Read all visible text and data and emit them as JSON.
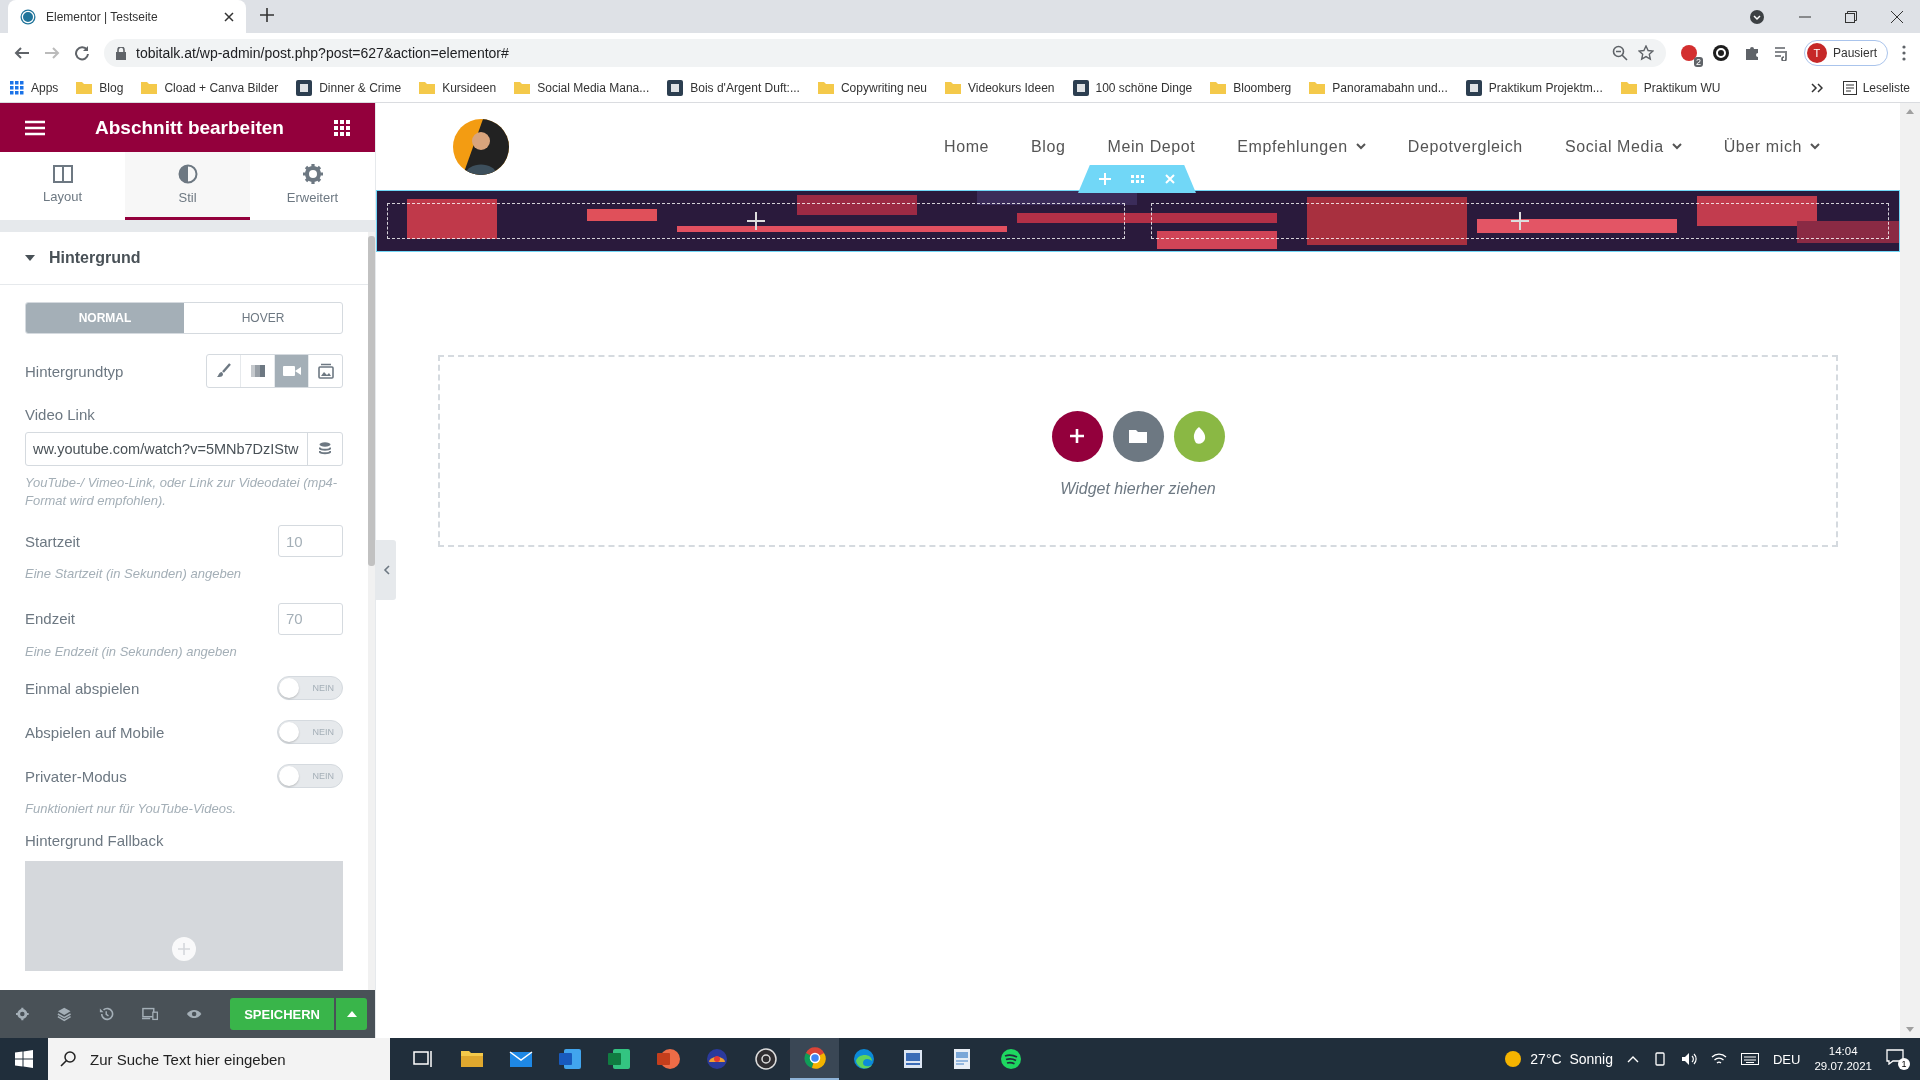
{
  "browser": {
    "tab": {
      "title": "Elementor | Testseite"
    },
    "url": "tobitalk.at/wp-admin/post.php?post=627&action=elementor#",
    "extension_badge": "2",
    "profile": {
      "initial": "T",
      "label": "Pausiert"
    },
    "bookmarks": [
      {
        "label": "Apps",
        "kind": "apps"
      },
      {
        "label": "Blog",
        "kind": "folder"
      },
      {
        "label": "Cload + Canva Bilder",
        "kind": "folder"
      },
      {
        "label": "Dinner & Crime",
        "kind": "site"
      },
      {
        "label": "Kursideen",
        "kind": "folder"
      },
      {
        "label": "Social Media Mana...",
        "kind": "folder"
      },
      {
        "label": "Bois d'Argent Duft:...",
        "kind": "site"
      },
      {
        "label": "Copywriting neu",
        "kind": "folder"
      },
      {
        "label": "Videokurs Ideen",
        "kind": "folder"
      },
      {
        "label": "100 schöne Dinge",
        "kind": "site"
      },
      {
        "label": "Bloomberg",
        "kind": "folder"
      },
      {
        "label": "Panoramabahn und...",
        "kind": "folder"
      },
      {
        "label": "Praktikum Projektm...",
        "kind": "site"
      },
      {
        "label": "Praktikum WU",
        "kind": "folder"
      }
    ],
    "reading_list": "Leseliste"
  },
  "editor": {
    "title": "Abschnitt bearbeiten",
    "tabs": [
      {
        "label": "Layout",
        "kind": "layout",
        "selected": false
      },
      {
        "label": "Stil",
        "kind": "style",
        "selected": true
      },
      {
        "label": "Erweitert",
        "kind": "advanced",
        "selected": false
      }
    ],
    "section": {
      "title": "Hintergrund",
      "expanded": true
    },
    "state_tabs": [
      {
        "label": "NORMAL",
        "selected": true
      },
      {
        "label": "HOVER",
        "selected": false
      }
    ],
    "background_type": {
      "label": "Hintergrundtyp",
      "options": [
        {
          "kind": "classic",
          "selected": false
        },
        {
          "kind": "gradient",
          "selected": false
        },
        {
          "kind": "video",
          "selected": true
        },
        {
          "kind": "slideshow",
          "selected": false
        }
      ]
    },
    "video_link": {
      "label": "Video Link",
      "value": "ww.youtube.com/watch?v=5MNb7DzIStw",
      "hint": "YouTube-/ Vimeo-Link, oder Link zur Videodatei (mp4-Format wird empfohlen)."
    },
    "start_time": {
      "label": "Startzeit",
      "placeholder": "10",
      "hint": "Eine Startzeit (in Sekunden) angeben"
    },
    "end_time": {
      "label": "Endzeit",
      "placeholder": "70",
      "hint": "Eine Endzeit (in Sekunden) angeben"
    },
    "toggles": [
      {
        "label": "Einmal abspielen",
        "on": false,
        "text": "NEIN"
      },
      {
        "label": "Abspielen auf Mobile",
        "on": false,
        "text": "NEIN"
      },
      {
        "label": "Privater-Modus",
        "on": false,
        "text": "NEIN"
      }
    ],
    "privacy_hint": "Funktioniert nur für YouTube-Videos.",
    "fallback_label": "Hintergrund Fallback",
    "save_button": "SPEICHERN"
  },
  "preview": {
    "nav": [
      {
        "label": "Home",
        "has_dropdown": false
      },
      {
        "label": "Blog",
        "has_dropdown": false
      },
      {
        "label": "Mein Depot",
        "has_dropdown": false
      },
      {
        "label": "Empfehlungen",
        "has_dropdown": true
      },
      {
        "label": "Depotvergleich",
        "has_dropdown": false
      },
      {
        "label": "Social Media",
        "has_dropdown": true
      },
      {
        "label": "Über mich",
        "has_dropdown": true
      }
    ],
    "drop_hint": "Widget hierher ziehen"
  },
  "taskbar": {
    "search_placeholder": "Zur Suche Text hier eingeben",
    "weather": "27°C  Sonnig",
    "language": "DEU",
    "time": "14:04",
    "date": "29.07.2021",
    "notifications": "1"
  }
}
